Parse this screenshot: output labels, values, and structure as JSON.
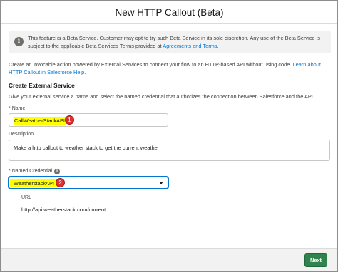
{
  "modal": {
    "title": "New HTTP Callout (Beta)"
  },
  "notice": {
    "icon": "info-icon",
    "text": "This feature is a Beta Service. Customer may opt to try such Beta Service in its sole discretion. Any use of the Beta Service is subject to the applicable Beta Services Terms provided at ",
    "link_label": "Agreements and Terms",
    "text_end": "."
  },
  "intro": {
    "text": "Create an invocable action powered by External Services to connect your flow to an HTTP-based API without using code. ",
    "link_label": "Learn about HTTP Callout in Salesforce Help",
    "text_end": "."
  },
  "section": {
    "title": "Create External Service",
    "description": "Give your external service a name and select the named credential that authorizes the connection between Salesforce and the API."
  },
  "fields": {
    "name": {
      "required_mark": "*",
      "label": "Name",
      "value": "CallWeatherStackAPI",
      "badge": "1"
    },
    "description": {
      "label": "Description",
      "value": "Make a http callout to weather stack to get the current weather"
    },
    "named_credential": {
      "required_mark": "*",
      "label": "Named Credential",
      "value": "WeatherstackAPI",
      "badge": "2",
      "info_icon": "info-icon"
    },
    "url": {
      "label": "URL",
      "value": "http://api.weatherstack.com/current"
    }
  },
  "footer": {
    "next_label": "Next"
  },
  "colors": {
    "highlight": "#ffff00",
    "badge": "#e03131",
    "next_button": "#2e844a",
    "link": "#0176d3"
  }
}
